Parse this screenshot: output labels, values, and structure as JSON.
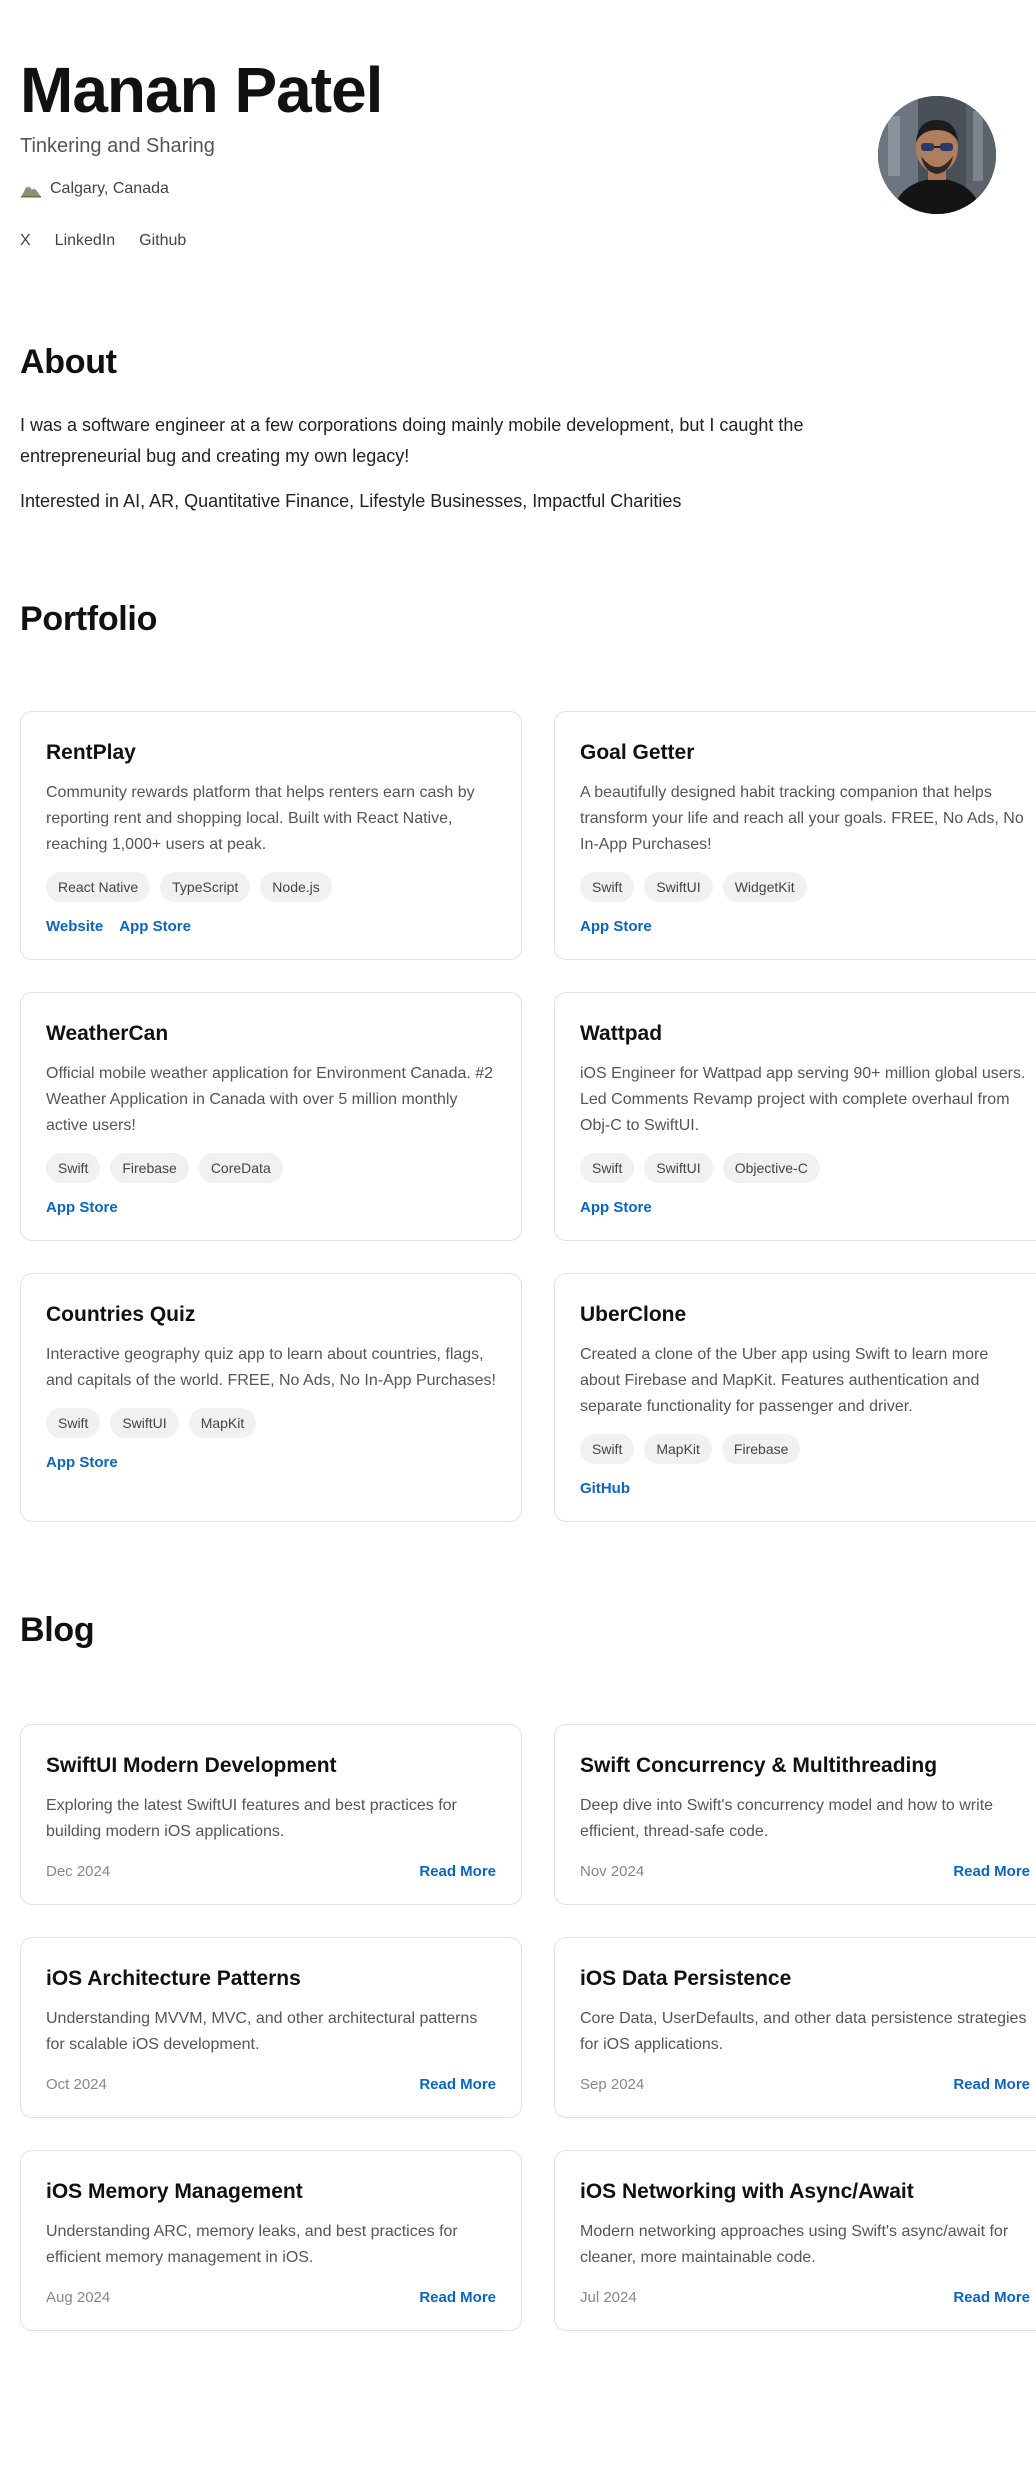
{
  "profile": {
    "name": "Manan Patel",
    "tagline": "Tinkering and Sharing",
    "location": "Calgary, Canada",
    "location_icon": "mountain-icon"
  },
  "social_links": [
    {
      "label": "X"
    },
    {
      "label": "LinkedIn"
    },
    {
      "label": "Github"
    }
  ],
  "about": {
    "title": "About",
    "paragraph1": "I was a software engineer at a few corporations doing mainly mobile development, but I caught the entrepreneurial bug and creating my own legacy!",
    "paragraph2": "Interested in AI, AR, Quantitative Finance, Lifestyle Businesses, Impactful Charities"
  },
  "portfolio": {
    "title": "Portfolio",
    "projects": [
      {
        "title": "RentPlay",
        "description": "Community rewards platform that helps renters earn cash by reporting rent and shopping local. Built with React Native, reaching 1,000+ users at peak.",
        "tags": [
          "React Native",
          "TypeScript",
          "Node.js"
        ],
        "links": [
          "Website",
          "App Store"
        ]
      },
      {
        "title": "Goal Getter",
        "description": "A beautifully designed habit tracking companion that helps transform your life and reach all your goals. FREE, No Ads, No In-App Purchases!",
        "tags": [
          "Swift",
          "SwiftUI",
          "WidgetKit"
        ],
        "links": [
          "App Store"
        ]
      },
      {
        "title": "WeatherCan",
        "description": "Official mobile weather application for Environment Canada. #2 Weather Application in Canada with over 5 million monthly active users!",
        "tags": [
          "Swift",
          "Firebase",
          "CoreData"
        ],
        "links": [
          "App Store"
        ]
      },
      {
        "title": "Wattpad",
        "description": "iOS Engineer for Wattpad app serving 90+ million global users. Led Comments Revamp project with complete overhaul from Obj-C to SwiftUI.",
        "tags": [
          "Swift",
          "SwiftUI",
          "Objective-C"
        ],
        "links": [
          "App Store"
        ]
      },
      {
        "title": "Countries Quiz",
        "description": "Interactive geography quiz app to learn about countries, flags, and capitals of the world. FREE, No Ads, No In-App Purchases!",
        "tags": [
          "Swift",
          "SwiftUI",
          "MapKit"
        ],
        "links": [
          "App Store"
        ]
      },
      {
        "title": "UberClone",
        "description": "Created a clone of the Uber app using Swift to learn more about Firebase and MapKit. Features authentication and separate functionality for passenger and driver.",
        "tags": [
          "Swift",
          "MapKit",
          "Firebase"
        ],
        "links": [
          "GitHub"
        ]
      }
    ]
  },
  "blog": {
    "title": "Blog",
    "read_more_label": "Read More",
    "posts": [
      {
        "title": "SwiftUI Modern Development",
        "description": "Exploring the latest SwiftUI features and best practices for building modern iOS applications.",
        "date": "Dec 2024"
      },
      {
        "title": "Swift Concurrency & Multithreading",
        "description": "Deep dive into Swift's concurrency model and how to write efficient, thread-safe code.",
        "date": "Nov 2024"
      },
      {
        "title": "iOS Architecture Patterns",
        "description": "Understanding MVVM, MVC, and other architectural patterns for scalable iOS development.",
        "date": "Oct 2024"
      },
      {
        "title": "iOS Data Persistence",
        "description": "Core Data, UserDefaults, and other data persistence strategies for iOS applications.",
        "date": "Sep 2024"
      },
      {
        "title": "iOS Memory Management",
        "description": "Understanding ARC, memory leaks, and best practices for efficient memory management in iOS.",
        "date": "Aug 2024"
      },
      {
        "title": "iOS Networking with Async/Await",
        "description": "Modern networking approaches using Swift's async/await for cleaner, more maintainable code.",
        "date": "Jul 2024"
      }
    ]
  },
  "colors": {
    "link": "#0a66c2",
    "tag_bg": "#f1f1f1",
    "card_border": "#e2e2e2"
  }
}
